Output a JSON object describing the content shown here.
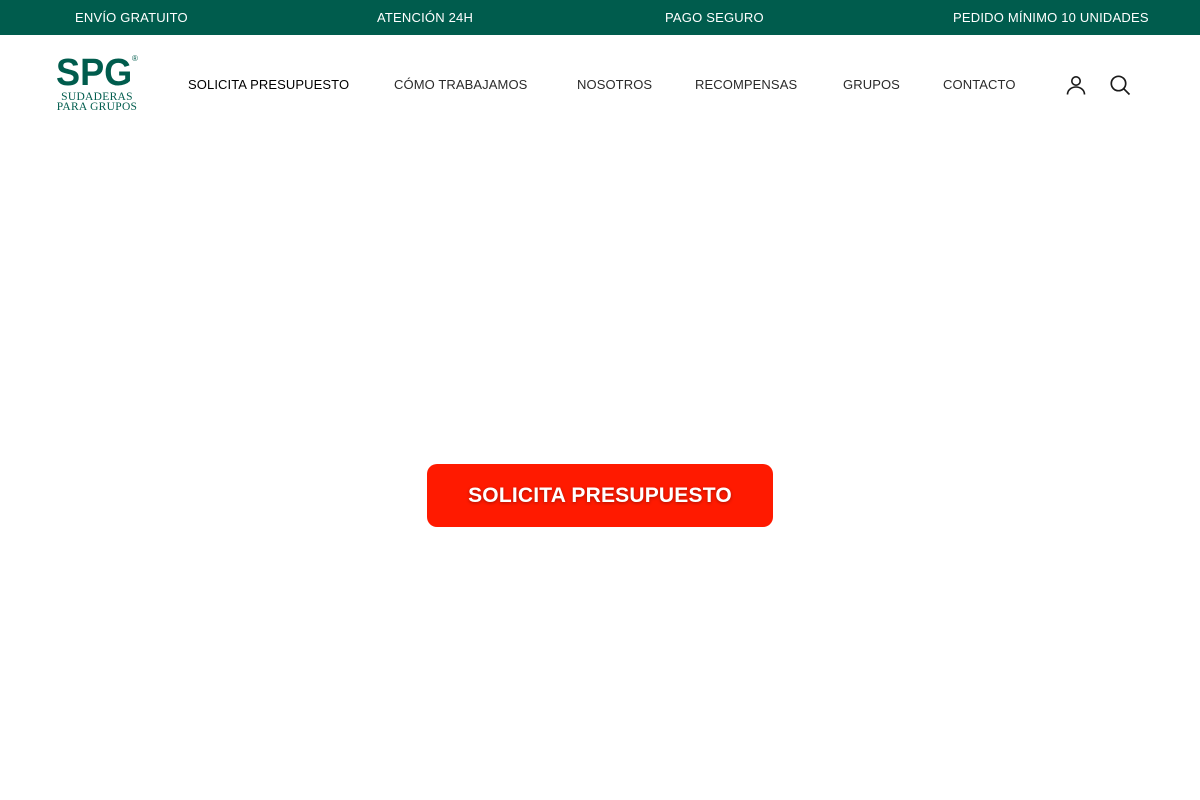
{
  "announcement_bar": {
    "messages": [
      "ENVÍO GRATUITO",
      "ATENCIÓN 24H",
      "PAGO SEGURO",
      "PEDIDO MÍNIMO 10 UNIDADES"
    ]
  },
  "header": {
    "logo": {
      "mark": "SPG",
      "registered": "®",
      "line1": "SUDADERAS",
      "line2": "PARA GRUPOS"
    },
    "nav": [
      {
        "label": "SOLICITA PRESUPUESTO",
        "active": true
      },
      {
        "label": "CÓMO TRABAJAMOS"
      },
      {
        "label": "NOSOTROS"
      },
      {
        "label": "RECOMPENSAS"
      },
      {
        "label": "GRUPOS"
      },
      {
        "label": "CONTACTO"
      }
    ],
    "icons": [
      "account-icon",
      "search-icon"
    ]
  },
  "hero": {
    "cta_label": "SOLICITA PRESUPUESTO"
  },
  "colors": {
    "brand_green": "#005c4d",
    "cta_red": "#ff1a00"
  }
}
